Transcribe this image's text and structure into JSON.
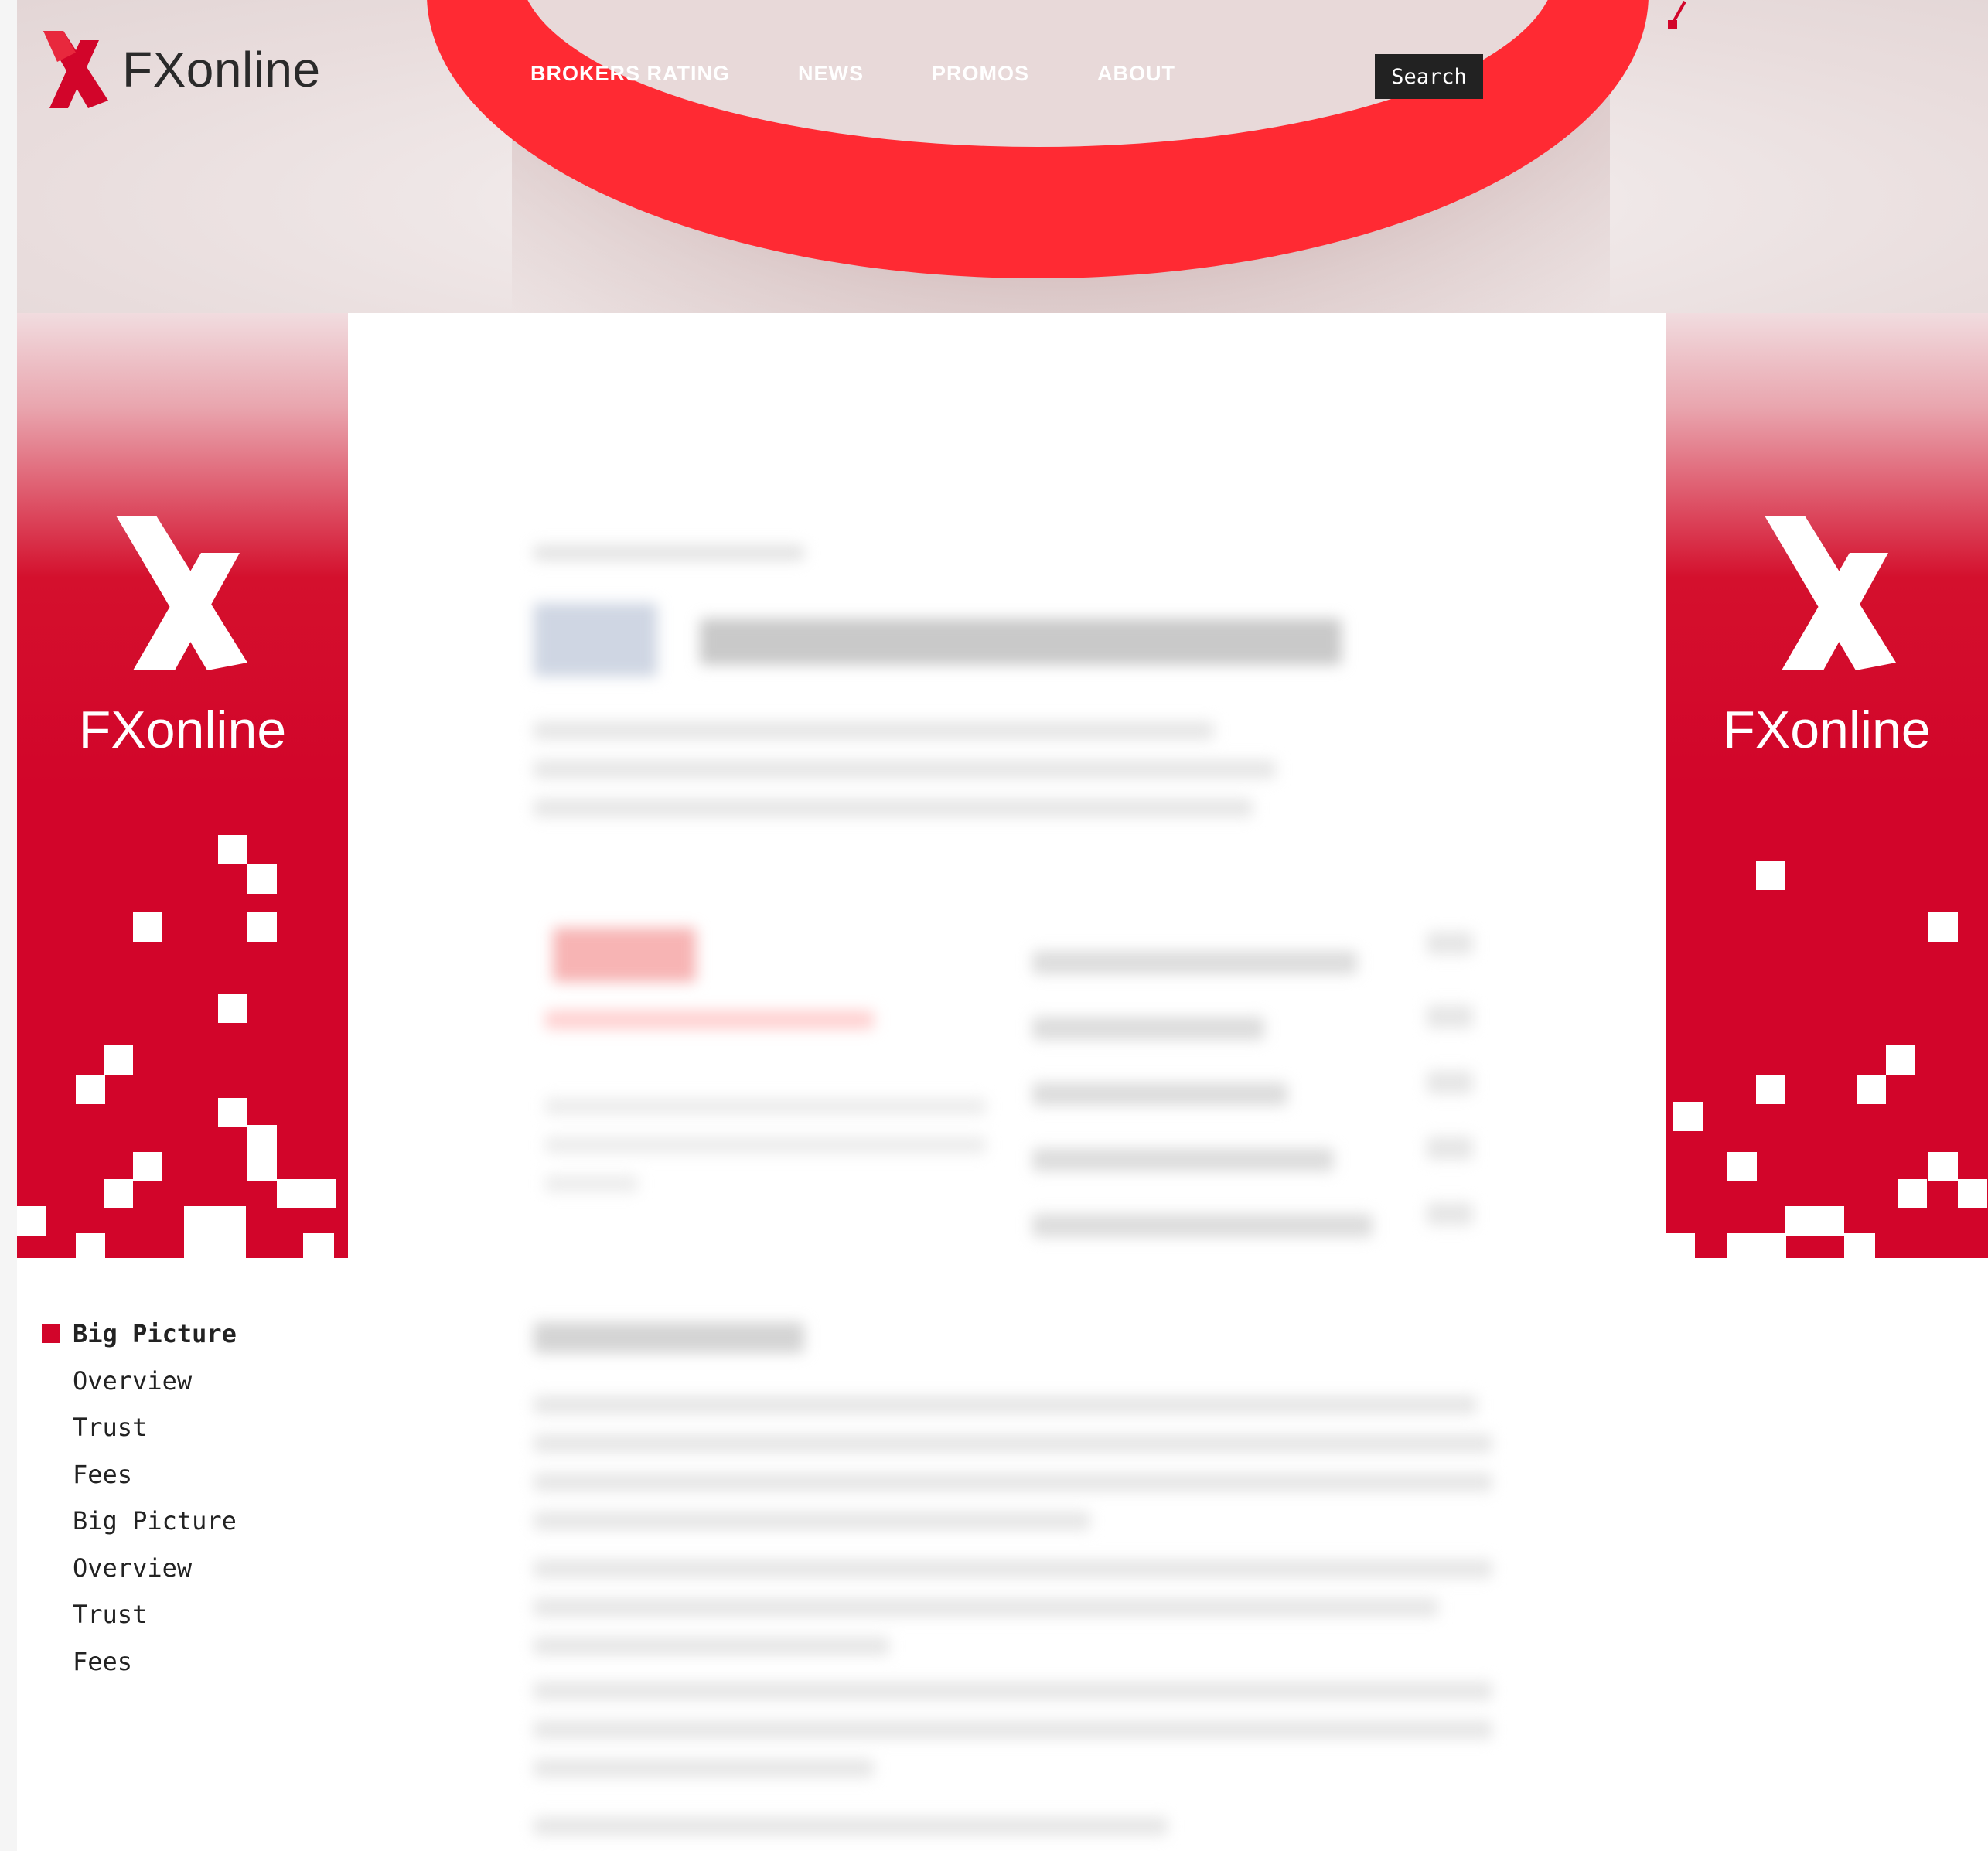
{
  "brand": {
    "name": "FXonline",
    "accent_color": "#d2052a",
    "logo_icon": "x-logo-icon"
  },
  "nav": {
    "items": [
      {
        "label": "BROKERS RATING"
      },
      {
        "label": "NEWS"
      },
      {
        "label": "PROMOS"
      },
      {
        "label": "ABOUT"
      }
    ],
    "search_label": "Search"
  },
  "side_ads": {
    "left": {
      "brand_text": "FXonline"
    },
    "right": {
      "brand_text": "FXonline"
    }
  },
  "toc": {
    "items": [
      {
        "label": "Big Picture",
        "active": true
      },
      {
        "label": "Overview",
        "active": false
      },
      {
        "label": "Trust",
        "active": false
      },
      {
        "label": "Fees",
        "active": false
      },
      {
        "label": "Big Picture",
        "active": false
      },
      {
        "label": "Overview",
        "active": false
      },
      {
        "label": "Trust",
        "active": false
      },
      {
        "label": "Fees",
        "active": false
      }
    ]
  }
}
